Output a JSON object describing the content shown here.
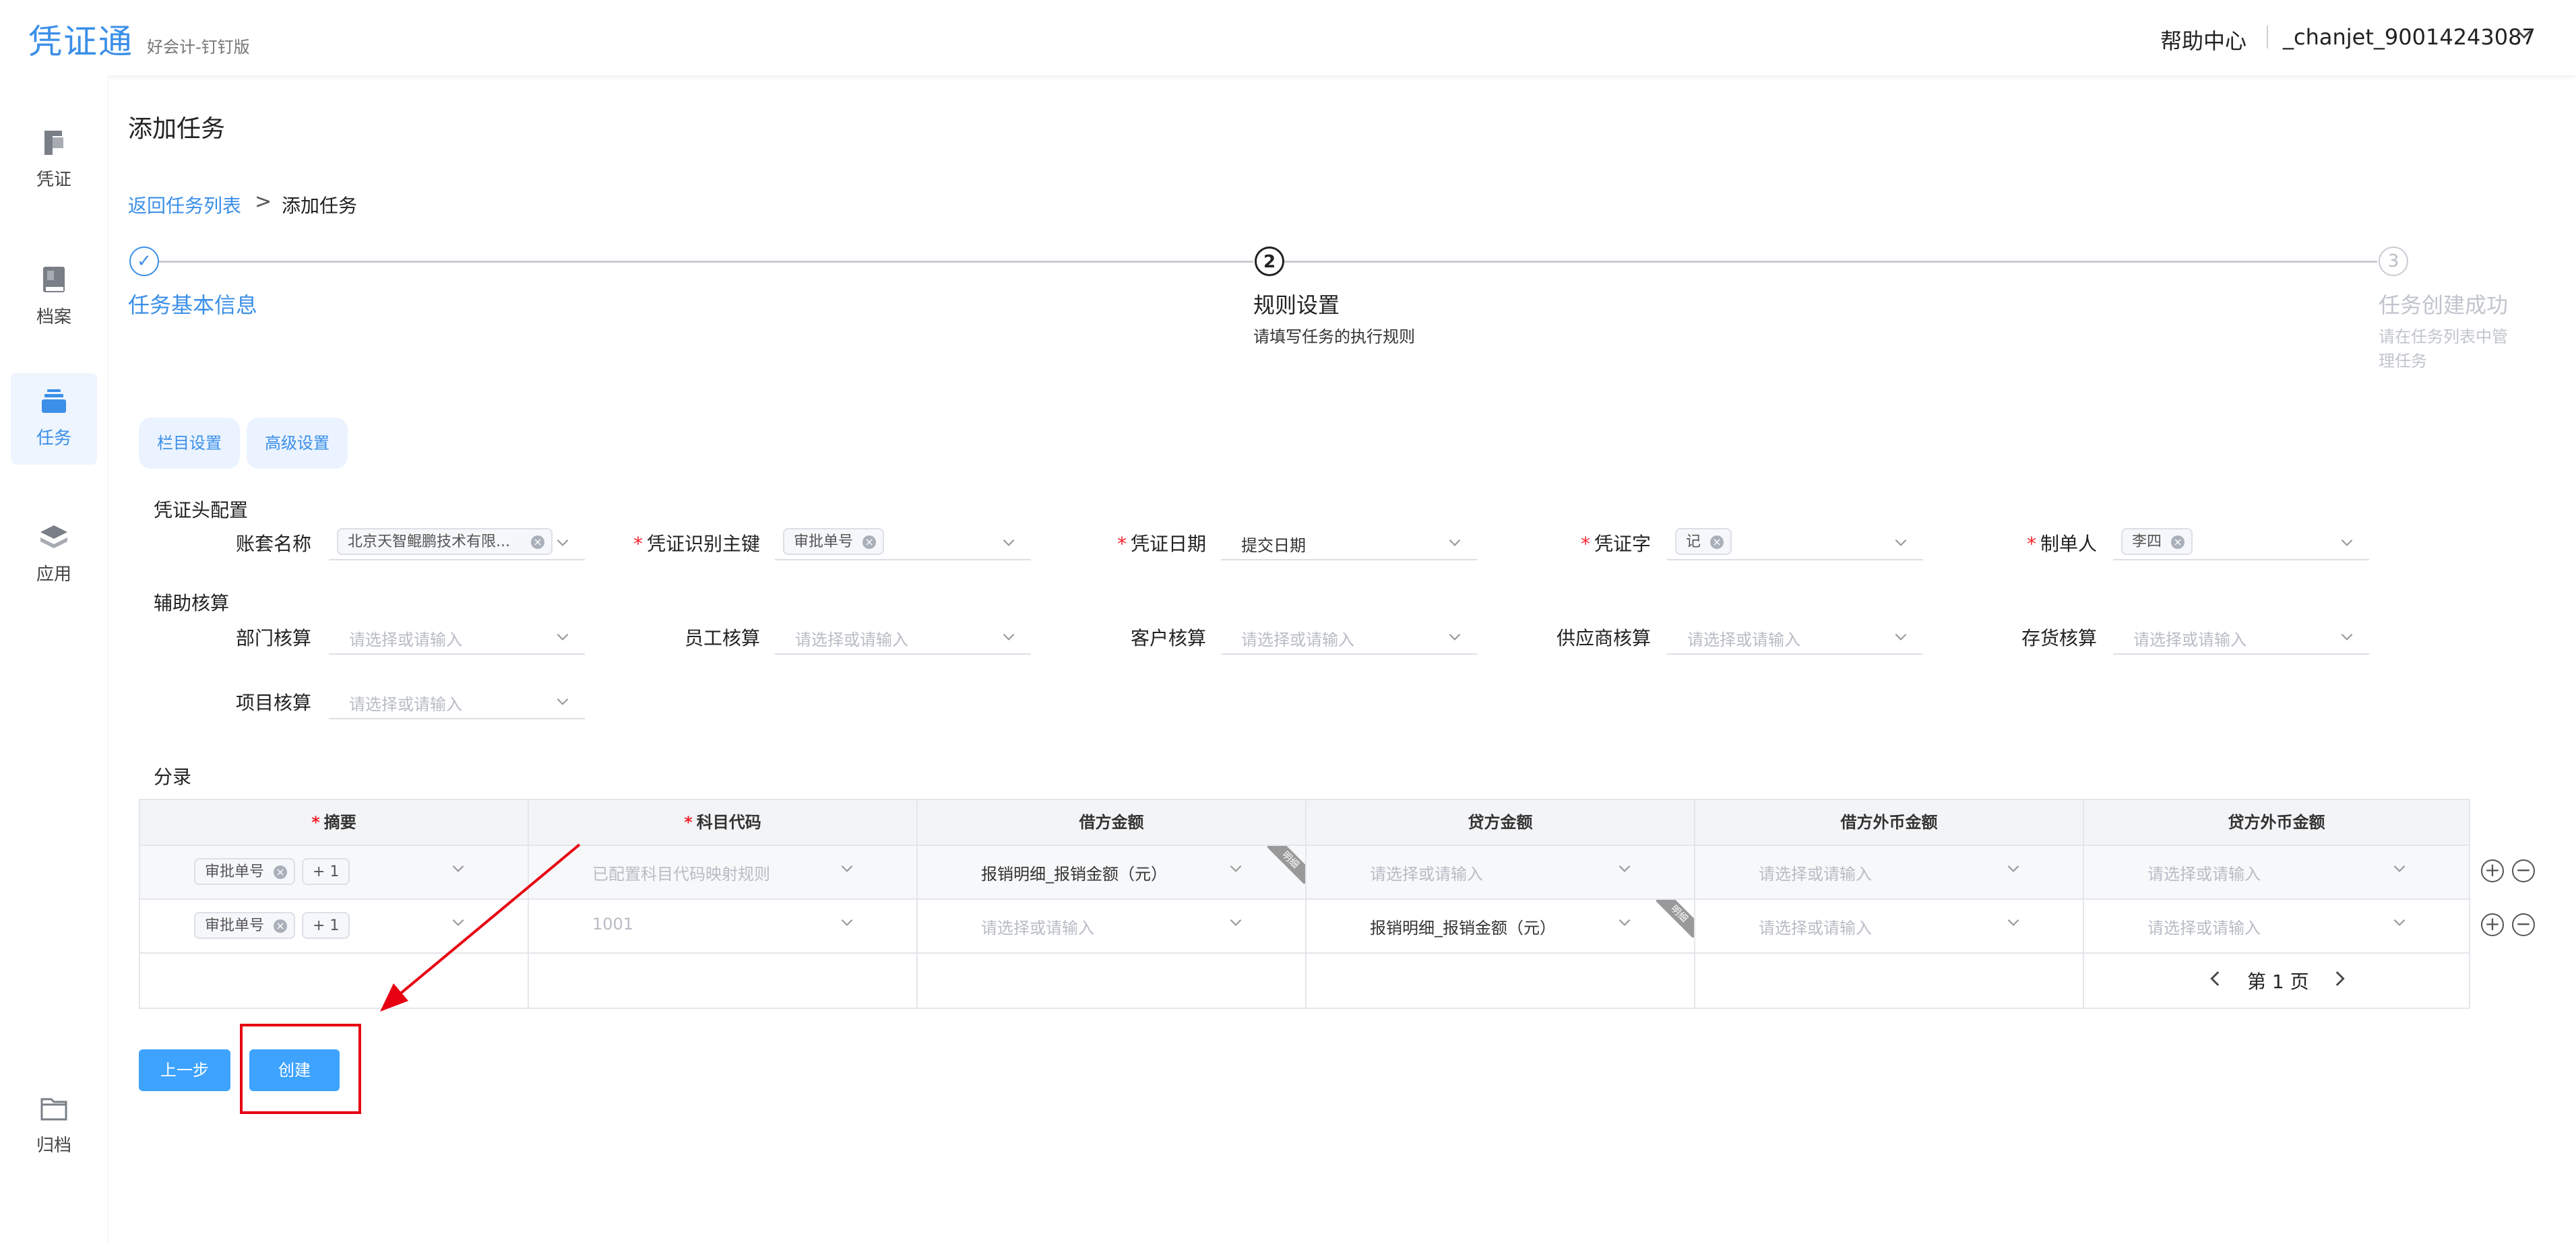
{
  "header": {
    "logo": "凭证通",
    "subtitle": "好会计-钉钉版",
    "help": "帮助中心",
    "user": "_chanjet_90014243087"
  },
  "sidebar": {
    "items": [
      {
        "label": "凭证",
        "icon": "voucher-icon"
      },
      {
        "label": "档案",
        "icon": "archive-book-icon"
      },
      {
        "label": "任务",
        "icon": "task-stack-icon",
        "active": true
      },
      {
        "label": "应用",
        "icon": "layers-icon"
      },
      {
        "label": "归档",
        "icon": "folder-icon"
      }
    ]
  },
  "page": {
    "title": "添加任务",
    "breadcrumb": {
      "back": "返回任务列表",
      "separator": ">",
      "current": "添加任务"
    }
  },
  "steps": [
    {
      "title": "任务基本信息",
      "status": "finished",
      "number": "✓"
    },
    {
      "title": "规则设置",
      "description": "请填写任务的执行规则",
      "status": "current",
      "number": "2"
    },
    {
      "title": "任务创建成功",
      "description": "请在任务列表中管理任务",
      "status": "waiting",
      "number": "3"
    }
  ],
  "tabs": [
    "栏目设置",
    "高级设置"
  ],
  "voucher_header": {
    "section": "凭证头配置",
    "fields": [
      {
        "label": "账套名称",
        "required": false,
        "chip": "北京天智鲲鹏技术有限..."
      },
      {
        "label": "凭证识别主键",
        "required": true,
        "chip": "审批单号"
      },
      {
        "label": "凭证日期",
        "required": true,
        "value": "提交日期"
      },
      {
        "label": "凭证字",
        "required": true,
        "chip": "记"
      },
      {
        "label": "制单人",
        "required": true,
        "chip": "李四"
      }
    ]
  },
  "aux": {
    "section": "辅助核算",
    "placeholder": "请选择或请输入",
    "fields": [
      "部门核算",
      "员工核算",
      "客户核算",
      "供应商核算",
      "存货核算",
      "项目核算"
    ]
  },
  "entries": {
    "section": "分录",
    "required_mark": "*",
    "columns": [
      {
        "label": "摘要",
        "required": true
      },
      {
        "label": "科目代码",
        "required": true
      },
      {
        "label": "借方金额",
        "required": false
      },
      {
        "label": "贷方金额",
        "required": false
      },
      {
        "label": "借方外币金额",
        "required": false
      },
      {
        "label": "贷方外币金额",
        "required": false
      }
    ],
    "rows": [
      {
        "summary_chip": "审批单号",
        "summary_more": "+ 1",
        "account": "已配置科目代码映射规则",
        "debit": "报销明细_报销金额（元）",
        "debit_badge": "明细",
        "credit": "请选择或请输入",
        "debit_fx": "请选择或请输入",
        "credit_fx": "请选择或请输入"
      },
      {
        "summary_chip": "审批单号",
        "summary_more": "+ 1",
        "account": "1001",
        "debit": "请选择或请输入",
        "credit": "报销明细_报销金额（元）",
        "credit_badge": "明细",
        "debit_fx": "请选择或请输入",
        "credit_fx": "请选择或请输入"
      }
    ],
    "pager": "第 1 页"
  },
  "buttons": {
    "prev": "上一步",
    "create": "创建"
  },
  "colors": {
    "accent": "#3b8fe8",
    "button": "#3ea3ff",
    "highlight": "#e60012",
    "required": "#f5222d"
  }
}
